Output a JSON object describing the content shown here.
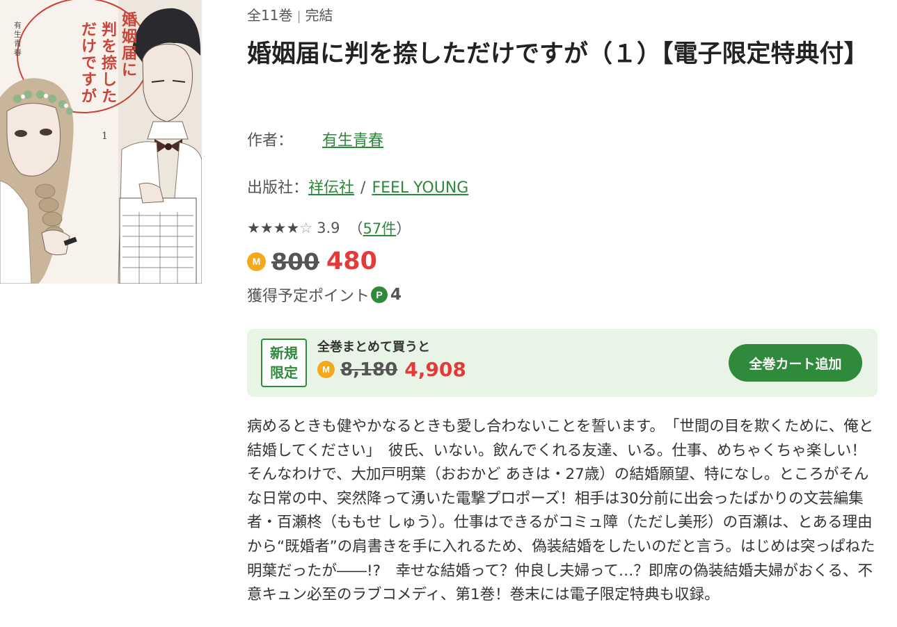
{
  "series": {
    "volumes": "全11巻",
    "status": "完結"
  },
  "title": "婚姻届に判を捺しただけですが（１）【電子限定特典付】",
  "author": {
    "label": "作者：",
    "name": "有生青春"
  },
  "publisher": {
    "label": "出版社：",
    "name": "祥伝社",
    "label_name": "FEEL YOUNG"
  },
  "rating": {
    "stars": 4,
    "max": 5,
    "score": "3.9",
    "reviews": "57件"
  },
  "price": {
    "coin": "M",
    "original": "800",
    "sale": "480"
  },
  "points": {
    "label": "獲得予定ポイント",
    "icon": "P",
    "value": "4"
  },
  "bundle": {
    "badge_line1": "新規",
    "badge_line2": "限定",
    "label": "全巻まとめて買うと",
    "original": "8,180",
    "sale": "4,908",
    "cart_button": "全巻カート追加"
  },
  "cover": {
    "title_text": "婚姻届に判を捺しただけですが",
    "author_text": "有生青春",
    "volume": "1"
  },
  "description": "病めるときも健やかなるときも愛し合わないことを誓います。　「世間の目を欺くために、俺と結婚してください」　彼氏、いない。飲んでくれる友達、いる。仕事、めちゃくちゃ楽しい！そんなわけで、大加戸明葉（おおかど あきは・27歳）の結婚願望、特になし。ところがそんな日常の中、突然降って湧いた電撃プロポーズ！相手は30分前に出会ったばかりの文芸編集者・百瀬柊（ももせ しゅう）。仕事はできるがコミュ障（ただし美形）の百瀬は、とある理由から“既婚者”の肩書きを手に入れるため、偽装結婚をしたいのだと言う。はじめは突っぱねた明葉だったが――!?　幸せな結婚って？仲良し夫婦って…？即席の偽装結婚夫婦がおくる、不意キュン必至のラブコメディ、第1巻！巻末には電子限定特典も収録。",
  "colors": {
    "accent_green": "#2f8a3c",
    "sale_red": "#e63a3a",
    "coin_orange": "#f5a81c",
    "bundle_bg": "#e8f4e6"
  }
}
